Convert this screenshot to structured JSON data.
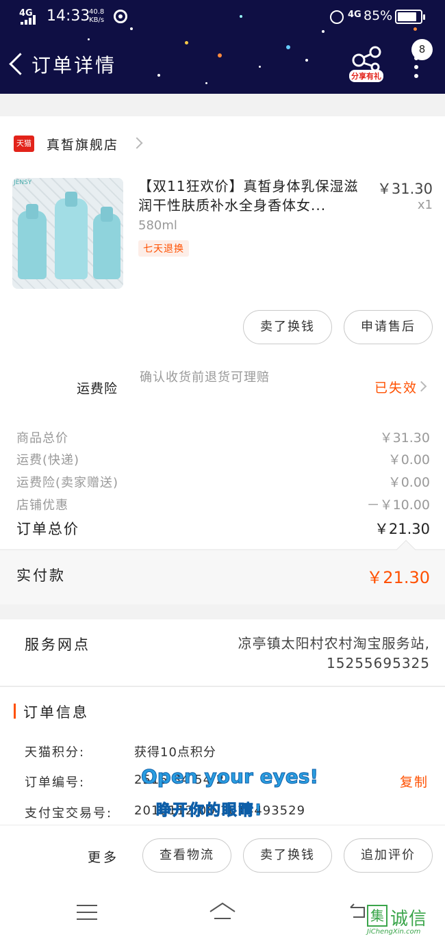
{
  "status_bar": {
    "network": "4G",
    "time": "14:33",
    "speed_value": "40.8",
    "speed_unit": "KB/s",
    "network_right": "4G",
    "battery": "85%",
    "battery_level": 0.85
  },
  "header": {
    "title": "订单详情",
    "share_badge": "分享有礼",
    "message_count": "8"
  },
  "shop": {
    "logo_text": "天猫",
    "name": "真皙旗舰店"
  },
  "product": {
    "brand": "JENSY",
    "title": "【双11狂欢价】真皙身体乳保湿滋润干性肤质补水全身香体女...",
    "sku": "580ml",
    "badge": "七天退换",
    "price": "￥31.30",
    "quantity": "x1"
  },
  "item_actions": {
    "sell_label": "卖了换钱",
    "after_sale_label": "申请售后"
  },
  "insurance": {
    "label": "运费险",
    "description": "确认收货前退货可理赔",
    "status": "已失效"
  },
  "fees": [
    {
      "label": "商品总价",
      "value": "￥31.30"
    },
    {
      "label": "运费(快递)",
      "value": "￥0.00"
    },
    {
      "label": "运费险(卖家赠送)",
      "value": "￥0.00"
    },
    {
      "label": "店铺优惠",
      "value": "－￥10.00"
    }
  ],
  "total": {
    "label": "订单总价",
    "value": "￥21.30"
  },
  "paid": {
    "label": "实付款",
    "value": "￥21.30"
  },
  "service": {
    "label": "服务网点",
    "line1": "凉亭镇太阳村农村淘宝服务站,",
    "line2": "15255695325"
  },
  "order_info": {
    "title": "订单信息",
    "rows": [
      {
        "label": "天猫积分:",
        "value": "获得10点积分"
      },
      {
        "label": "订单编号:",
        "value": "2515    84    54    2"
      },
      {
        "label": "支付宝交易号:",
        "value": "2018112   00   1014493529"
      }
    ],
    "copy_label": "复制"
  },
  "overlay": {
    "english": "Open your eyes!",
    "chinese": "睁开你的眼睛!"
  },
  "bottom_actions": {
    "more_label": "更多",
    "logistics_label": "查看物流",
    "sell_label": "卖了换钱",
    "review_label": "追加评价"
  },
  "watermark": {
    "logo": "集",
    "text": "诚信",
    "url": "JiChengXin.com"
  },
  "colors": {
    "header_bg": "#0f0f44",
    "accent": "#ff5000",
    "tmall_red": "#e2231a",
    "overlay_blue": "#2a9de0",
    "watermark_green": "#3aa54a"
  }
}
